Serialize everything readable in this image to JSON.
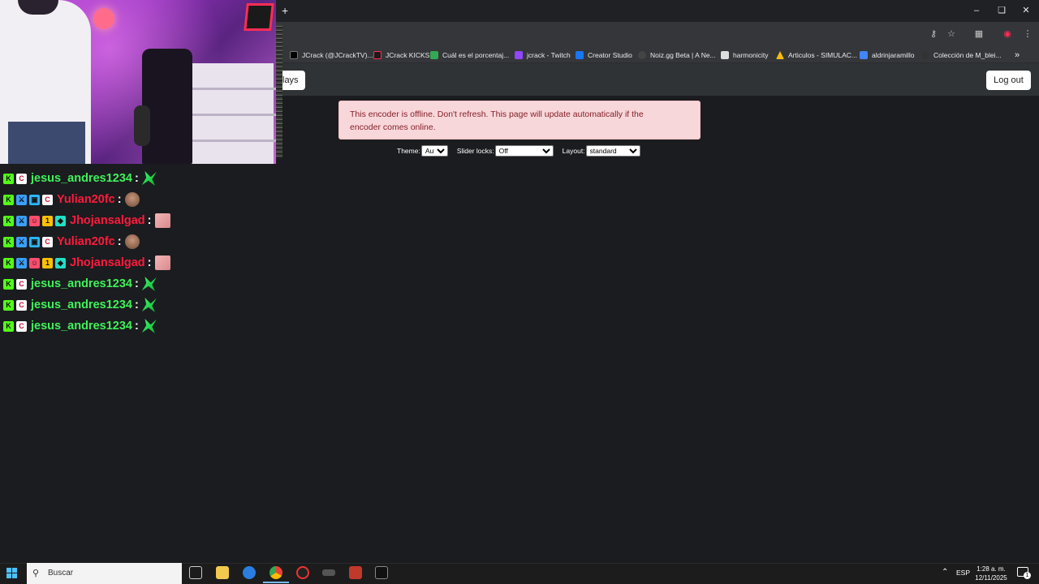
{
  "browser": {
    "new_tab_icon": "plus-icon",
    "window_controls": [
      "minimize-icon",
      "restore-icon",
      "close-icon"
    ],
    "bookmarks": [
      {
        "label": "JCrack (@JCrackTV)...",
        "icon": "x-logo-icon",
        "color": "#000000"
      },
      {
        "label": "JCrack KICKS",
        "icon": "jc-logo-icon",
        "color": "#1b1b1b"
      },
      {
        "label": "Cuál es el porcentaj...",
        "icon": "doc-icon",
        "color": "#34a853"
      },
      {
        "label": "jcrack - Twitch",
        "icon": "twitch-icon",
        "color": "#9146ff"
      },
      {
        "label": "Creator Studio",
        "icon": "facebook-icon",
        "color": "#1877f2"
      },
      {
        "label": "Noiz.gg Beta | A Ne...",
        "icon": "noiz-icon",
        "color": "#444444"
      },
      {
        "label": "harmonicity",
        "icon": "harmonicity-icon",
        "color": "#dddddd"
      },
      {
        "label": "Articulos - SIMULAC...",
        "icon": "drive-icon",
        "color": "#fbbc04"
      },
      {
        "label": "aldrinjaramillo",
        "icon": "calendar-icon",
        "color": "#4285f4"
      },
      {
        "label": "Colección de M_blei...",
        "icon": "github-icon",
        "color": "#333333"
      }
    ]
  },
  "page": {
    "plays_label": "lays",
    "logout_label": "Log out",
    "alert_text": "This encoder is offline. Don't refresh. This page will update automatically if the encoder comes online.",
    "theme_label": "Theme:",
    "theme_value": "Auto",
    "slider_label": "Slider locks:",
    "slider_value": "Off",
    "layout_label": "Layout:",
    "layout_value": "standard"
  },
  "chat": {
    "colors": {
      "green": "#3ff25a",
      "red": "#ff1a3c"
    },
    "messages": [
      {
        "user": "jesus_andres1234",
        "color": "green",
        "badges": [
          "kick",
          "jc"
        ],
        "emote": "green"
      },
      {
        "user": "Yulian20fc",
        "color": "red",
        "badges": [
          "kick",
          "sword",
          "cube",
          "jc"
        ],
        "emote": "face"
      },
      {
        "user": "Jhojansalgad",
        "color": "red",
        "badges": [
          "kick",
          "sword",
          "mask",
          "one",
          "gem"
        ],
        "emote": "pink"
      },
      {
        "user": "Yulian20fc",
        "color": "red",
        "badges": [
          "kick",
          "sword",
          "cube",
          "jc"
        ],
        "emote": "face"
      },
      {
        "user": "Jhojansalgad",
        "color": "red",
        "badges": [
          "kick",
          "sword",
          "mask",
          "one",
          "gem"
        ],
        "emote": "pink"
      },
      {
        "user": "jesus_andres1234",
        "color": "green",
        "badges": [
          "kick",
          "jc"
        ],
        "emote": "green"
      },
      {
        "user": "jesus_andres1234",
        "color": "green",
        "badges": [
          "kick",
          "jc"
        ],
        "emote": "green"
      },
      {
        "user": "jesus_andres1234",
        "color": "green",
        "badges": [
          "kick",
          "jc"
        ],
        "emote": "green"
      }
    ]
  },
  "taskbar": {
    "search_placeholder": "Buscar",
    "lang": "ESP",
    "time": "1:28 a. m.",
    "date": "12/11/2025",
    "notification_count": "1"
  }
}
